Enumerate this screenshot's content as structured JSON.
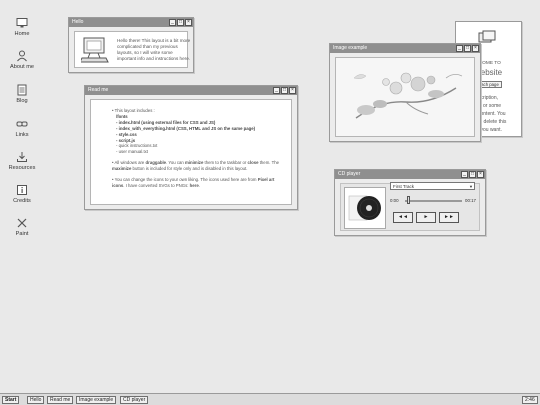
{
  "desktop_icons": [
    {
      "label": "Home"
    },
    {
      "label": "About me"
    },
    {
      "label": "Blog"
    },
    {
      "label": "Links"
    },
    {
      "label": "Resources"
    },
    {
      "label": "Credits"
    },
    {
      "label": "Paint"
    }
  ],
  "hello_window": {
    "title": "Hello",
    "text": "Hello there! This layout is a bit more complicated than my previous layouts, so I will write some important info and instructions here."
  },
  "readme_window": {
    "title": "Read me",
    "intro": "This layout includes :",
    "files": [
      "/fonts",
      "- index.html (using external files for CSS and JS)",
      "- index_with_everything.html (CSS, HTML and JS on the same page)",
      "- style.css",
      "- script.js",
      "- quick instructions.txt",
      "- user manual.txt"
    ],
    "p2_a": "All windows are ",
    "p2_b": "draggable",
    "p2_c": ". You can ",
    "p2_d": "minimize",
    "p2_e": " them to the taskbar or ",
    "p2_f": "close",
    "p2_g": " them. The ",
    "p2_h": "maximize",
    "p2_i": " button is included for style only and is disabled in this layout.",
    "p3_a": "You can change the icons to your own liking. The icons used here are from ",
    "p3_b": "Pixel art icons",
    "p3_c": ". I have converted SVGs to PNGs: ",
    "p3_d": "here",
    "p3_e": "."
  },
  "image_window": {
    "title": "Image example"
  },
  "cd_window": {
    "title": "CD player",
    "track": "First Track",
    "time_current": "0:00",
    "time_total": "00:17",
    "progress_fraction": 0.05,
    "btn_prev": "◄◄",
    "btn_play": "►",
    "btn_next": "►►"
  },
  "partial_window": {
    "line1": "LCOME TO",
    "line2": "website",
    "btn": "ach page",
    "lines": [
      "scription,",
      "w or some",
      "content. You",
      "to delete this",
      "l you want."
    ]
  },
  "taskbar": {
    "start": "Start",
    "items": [
      "Hello",
      "Read me",
      "Image example",
      "CD player"
    ],
    "clock": "2:46"
  },
  "colors": {
    "desktop": "#e9e9e9",
    "titlebar": "#8f8f8f",
    "window": "#ececec"
  }
}
